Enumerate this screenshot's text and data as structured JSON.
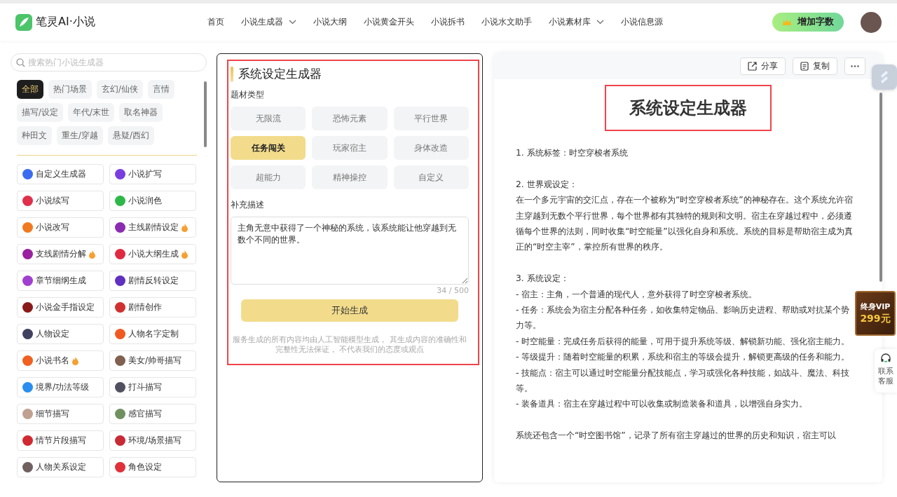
{
  "header": {
    "logo": "笔灵AI·小说",
    "nav": [
      {
        "label": "首页",
        "dropdown": false
      },
      {
        "label": "小说生成器",
        "dropdown": true
      },
      {
        "label": "小说大纲",
        "dropdown": false
      },
      {
        "label": "小说黄金开头",
        "dropdown": false
      },
      {
        "label": "小说拆书",
        "dropdown": false
      },
      {
        "label": "小说水文助手",
        "dropdown": false
      },
      {
        "label": "小说素材库",
        "dropdown": true
      },
      {
        "label": "小说信息源",
        "dropdown": false
      }
    ],
    "cta": "增加字数"
  },
  "sidebar": {
    "search": {
      "placeholder": "搜索热门小说生成器"
    },
    "tags": [
      {
        "label": "全部",
        "selected": true
      },
      {
        "label": "热门场景",
        "selected": false
      },
      {
        "label": "玄幻/仙侠",
        "selected": false
      },
      {
        "label": "言情",
        "selected": false
      },
      {
        "label": "描写/设定",
        "selected": false
      },
      {
        "label": "年代/末世",
        "selected": false
      },
      {
        "label": "取名神器",
        "selected": false
      },
      {
        "label": "种田文",
        "selected": false
      },
      {
        "label": "重生/穿越",
        "selected": false
      },
      {
        "label": "悬疑/西幻",
        "selected": false
      }
    ],
    "tools": [
      {
        "label": "自定义生成器",
        "color": "#3b6cf0",
        "hot": false
      },
      {
        "label": "小说扩写",
        "color": "#7a3de0",
        "hot": false
      },
      {
        "label": "小说续写",
        "color": "#e0304a",
        "hot": false
      },
      {
        "label": "小说润色",
        "color": "#2fb84a",
        "hot": false
      },
      {
        "label": "小说改写",
        "color": "#f07a20",
        "hot": false
      },
      {
        "label": "主线剧情设定",
        "color": "#8a2bb0",
        "hot": true
      },
      {
        "label": "支线剧情分解",
        "color": "#9a20a0",
        "hot": true
      },
      {
        "label": "小说大纲生成",
        "color": "#e02a40",
        "hot": true
      },
      {
        "label": "章节细纲生成",
        "color": "#a040d0",
        "hot": false
      },
      {
        "label": "剧情反转设定",
        "color": "#6030c0",
        "hot": false
      },
      {
        "label": "小说金手指设定",
        "color": "#8a1a1a",
        "hot": false
      },
      {
        "label": "剧情创作",
        "color": "#d03030",
        "hot": false
      },
      {
        "label": "人物设定",
        "color": "#404060",
        "hot": false
      },
      {
        "label": "人物名字定制",
        "color": "#f05a20",
        "hot": false
      },
      {
        "label": "小说书名",
        "color": "#f06020",
        "hot": true
      },
      {
        "label": "美女/帅哥描写",
        "color": "#806050",
        "hot": false
      },
      {
        "label": "境界/功法等级",
        "color": "#2a8ef0",
        "hot": false
      },
      {
        "label": "打斗描写",
        "color": "#505060",
        "hot": false
      },
      {
        "label": "细节描写",
        "color": "#c0a090",
        "hot": false
      },
      {
        "label": "感官描写",
        "color": "#709060",
        "hot": false
      },
      {
        "label": "情节片段描写",
        "color": "#d02a30",
        "hot": false
      },
      {
        "label": "环境/场景描写",
        "color": "#c82a36",
        "hot": false
      },
      {
        "label": "人物关系设定",
        "color": "#706060",
        "hot": false
      },
      {
        "label": "角色设定",
        "color": "#e0303a",
        "hot": false
      }
    ]
  },
  "form": {
    "title": "系统设定生成器",
    "genre_label": "题材类型",
    "genres": [
      {
        "label": "无限流",
        "selected": false
      },
      {
        "label": "恐怖元素",
        "selected": false
      },
      {
        "label": "平行世界",
        "selected": false
      },
      {
        "label": "任务闯关",
        "selected": true
      },
      {
        "label": "玩家宿主",
        "selected": false
      },
      {
        "label": "身体改造",
        "selected": false
      },
      {
        "label": "超能力",
        "selected": false
      },
      {
        "label": "精神操控",
        "selected": false
      },
      {
        "label": "自定义",
        "selected": false
      }
    ],
    "description_label": "补充描述",
    "description": "主角无意中获得了一个神秘的系统，该系统能让他穿越到无数个不同的世界。",
    "counter": "34 / 500",
    "submit": "开始生成",
    "disclaimer": "服务生成的所有内容均由人工智能模型生成， 其生成内容的准确性和完整性无法保证， 不代表我们的态度或观点"
  },
  "result": {
    "actions": [
      {
        "kind": "share",
        "label": "分享"
      },
      {
        "kind": "copy",
        "label": "复制"
      },
      {
        "kind": "more"
      }
    ],
    "title": "系统设定生成器",
    "blocks": [
      [
        "1. 系统标签：时空穿梭者系统"
      ],
      [
        "2. 世界观设定：",
        "在一个多元宇宙的交汇点，存在一个被称为“时空穿梭者系统”的神秘存在。这个系统允许宿主穿越到无数个平行世界，每个世界都有其独特的规则和文明。宿主在穿越过程中，必须遵循每个世界的法则，同时收集“时空能量”以强化自身和系统。系统的目标是帮助宿主成为真正的“时空主宰”，掌控所有世界的秩序。"
      ],
      [
        "3. 系统设定：",
        "- 宿主：主角，一个普通的现代人，意外获得了时空穿梭者系统。",
        "- 任务：系统会为宿主分配各种任务，如收集特定物品、影响历史进程、帮助或对抗某个势力等。",
        "- 时空能量：完成任务后获得的能量，可用于提升系统等级、解锁新功能、强化宿主能力。",
        "- 等级提升：随着时空能量的积累，系统和宿主的等级会提升，解锁更高级的任务和能力。",
        "- 技能点：宿主可以通过时空能量分配技能点，学习或强化各种技能，如战斗、魔法、科技等。",
        "- 装备道具：宿主在穿越过程中可以收集或制造装备和道具，以增强自身实力。"
      ],
      [
        "系统还包含一个“时空图书馆”，记录了所有宿主穿越过的世界的历史和知识，宿主可以"
      ]
    ]
  },
  "floating": {
    "vip_line1": "终身VIP",
    "vip_line2": "299元",
    "support": "联系客服"
  }
}
